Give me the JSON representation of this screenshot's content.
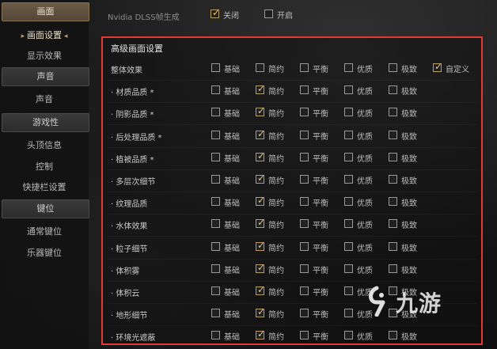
{
  "sidebar": {
    "sections": [
      {
        "label": "画面",
        "active": true,
        "items": [
          {
            "label": "画面设置",
            "selected": true
          },
          {
            "label": "显示效果",
            "selected": false
          }
        ]
      },
      {
        "label": "声音",
        "active": false,
        "items": [
          {
            "label": "声音",
            "selected": false
          }
        ]
      },
      {
        "label": "游戏性",
        "active": false,
        "items": [
          {
            "label": "头顶信息",
            "selected": false
          },
          {
            "label": "控制",
            "selected": false
          },
          {
            "label": "快捷栏设置",
            "selected": false
          }
        ]
      },
      {
        "label": "键位",
        "active": false,
        "items": [
          {
            "label": "通常键位",
            "selected": false
          },
          {
            "label": "乐器键位",
            "selected": false
          }
        ]
      }
    ]
  },
  "dlss": {
    "label": "Nvidia DLSS帧生成",
    "options": [
      {
        "label": "关闭",
        "checked": true
      },
      {
        "label": "开启",
        "checked": false
      }
    ]
  },
  "advanced": {
    "title": "高级画面设置",
    "rows": [
      {
        "label": "整体效果",
        "options": [
          "基础",
          "简约",
          "平衡",
          "优质",
          "极致",
          "自定义"
        ],
        "selected": 5
      },
      {
        "label": "· 材质品质 *",
        "options": [
          "基础",
          "简约",
          "平衡",
          "优质",
          "极致"
        ],
        "selected": 1
      },
      {
        "label": "· 阴影品质 *",
        "options": [
          "基础",
          "简约",
          "平衡",
          "优质",
          "极致"
        ],
        "selected": 1
      },
      {
        "label": "· 后处理品质 *",
        "options": [
          "基础",
          "简约",
          "平衡",
          "优质",
          "极致"
        ],
        "selected": 1
      },
      {
        "label": "· 植被品质 *",
        "options": [
          "基础",
          "简约",
          "平衡",
          "优质",
          "极致"
        ],
        "selected": 1
      },
      {
        "label": "· 多层次细节",
        "options": [
          "基础",
          "简约",
          "平衡",
          "优质",
          "极致"
        ],
        "selected": 1
      },
      {
        "label": "· 纹理品质",
        "options": [
          "基础",
          "简约",
          "平衡",
          "优质",
          "极致"
        ],
        "selected": 1
      },
      {
        "label": "· 水体效果",
        "options": [
          "基础",
          "简约",
          "平衡",
          "优质",
          "极致"
        ],
        "selected": 1
      },
      {
        "label": "· 粒子细节",
        "options": [
          "基础",
          "简约",
          "平衡",
          "优质",
          "极致"
        ],
        "selected": 1
      },
      {
        "label": "· 体积雾",
        "options": [
          "基础",
          "简约",
          "平衡",
          "优质",
          "极致"
        ],
        "selected": 1
      },
      {
        "label": "· 体积云",
        "options": [
          "基础",
          "简约",
          "平衡",
          "优质",
          "极致"
        ],
        "selected": 1
      },
      {
        "label": "· 地形细节",
        "options": [
          "基础",
          "简约",
          "平衡",
          "优质",
          "极致"
        ],
        "selected": 1
      },
      {
        "label": "· 环境光遮蔽",
        "options": [
          "基础",
          "简约",
          "平衡",
          "优质",
          "极致"
        ],
        "selected": 1
      }
    ]
  },
  "watermark": {
    "text": "九游",
    "icon": "9-logo-icon"
  },
  "colors": {
    "highlight_frame": "#e23a3a",
    "checkmark": "#e2c27a",
    "active_tab": "#6b5a45"
  }
}
